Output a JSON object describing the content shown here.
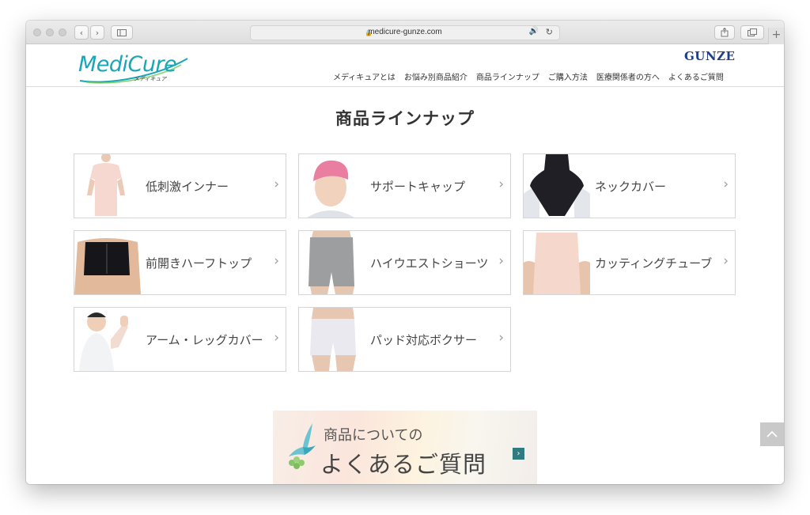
{
  "browser": {
    "url": "medicure-gunze.com"
  },
  "header": {
    "logo_text": "MediCure",
    "logo_sub": "メディキュア",
    "brand": "GUNZE",
    "nav": [
      "メディキュアとは",
      "お悩み別商品紹介",
      "商品ラインナップ",
      "ご購入方法",
      "医療関係者の方へ",
      "よくあるご質問"
    ]
  },
  "main": {
    "title": "商品ラインナップ",
    "products": [
      {
        "label": "低刺激インナー"
      },
      {
        "label": "サポートキャップ"
      },
      {
        "label": "ネックカバー"
      },
      {
        "label": "前開きハーフトップ"
      },
      {
        "label": "ハイウエストショーツ"
      },
      {
        "label": "カッティングチューブ"
      },
      {
        "label": "アーム・レッグカバー"
      },
      {
        "label": "パッド対応ボクサー"
      }
    ],
    "banner": {
      "line1": "商品についての",
      "line2": "よくあるご質問"
    }
  },
  "colors": {
    "logo": "#1aa6b7",
    "brand": "#1f3e88",
    "banner_arrow": "#2f7b80"
  },
  "icons": [
    "chevron-right-icon",
    "back-to-top-icon",
    "lock-icon",
    "speaker-icon",
    "reload-icon",
    "share-icon",
    "tabs-icon",
    "sidebar-icon"
  ]
}
